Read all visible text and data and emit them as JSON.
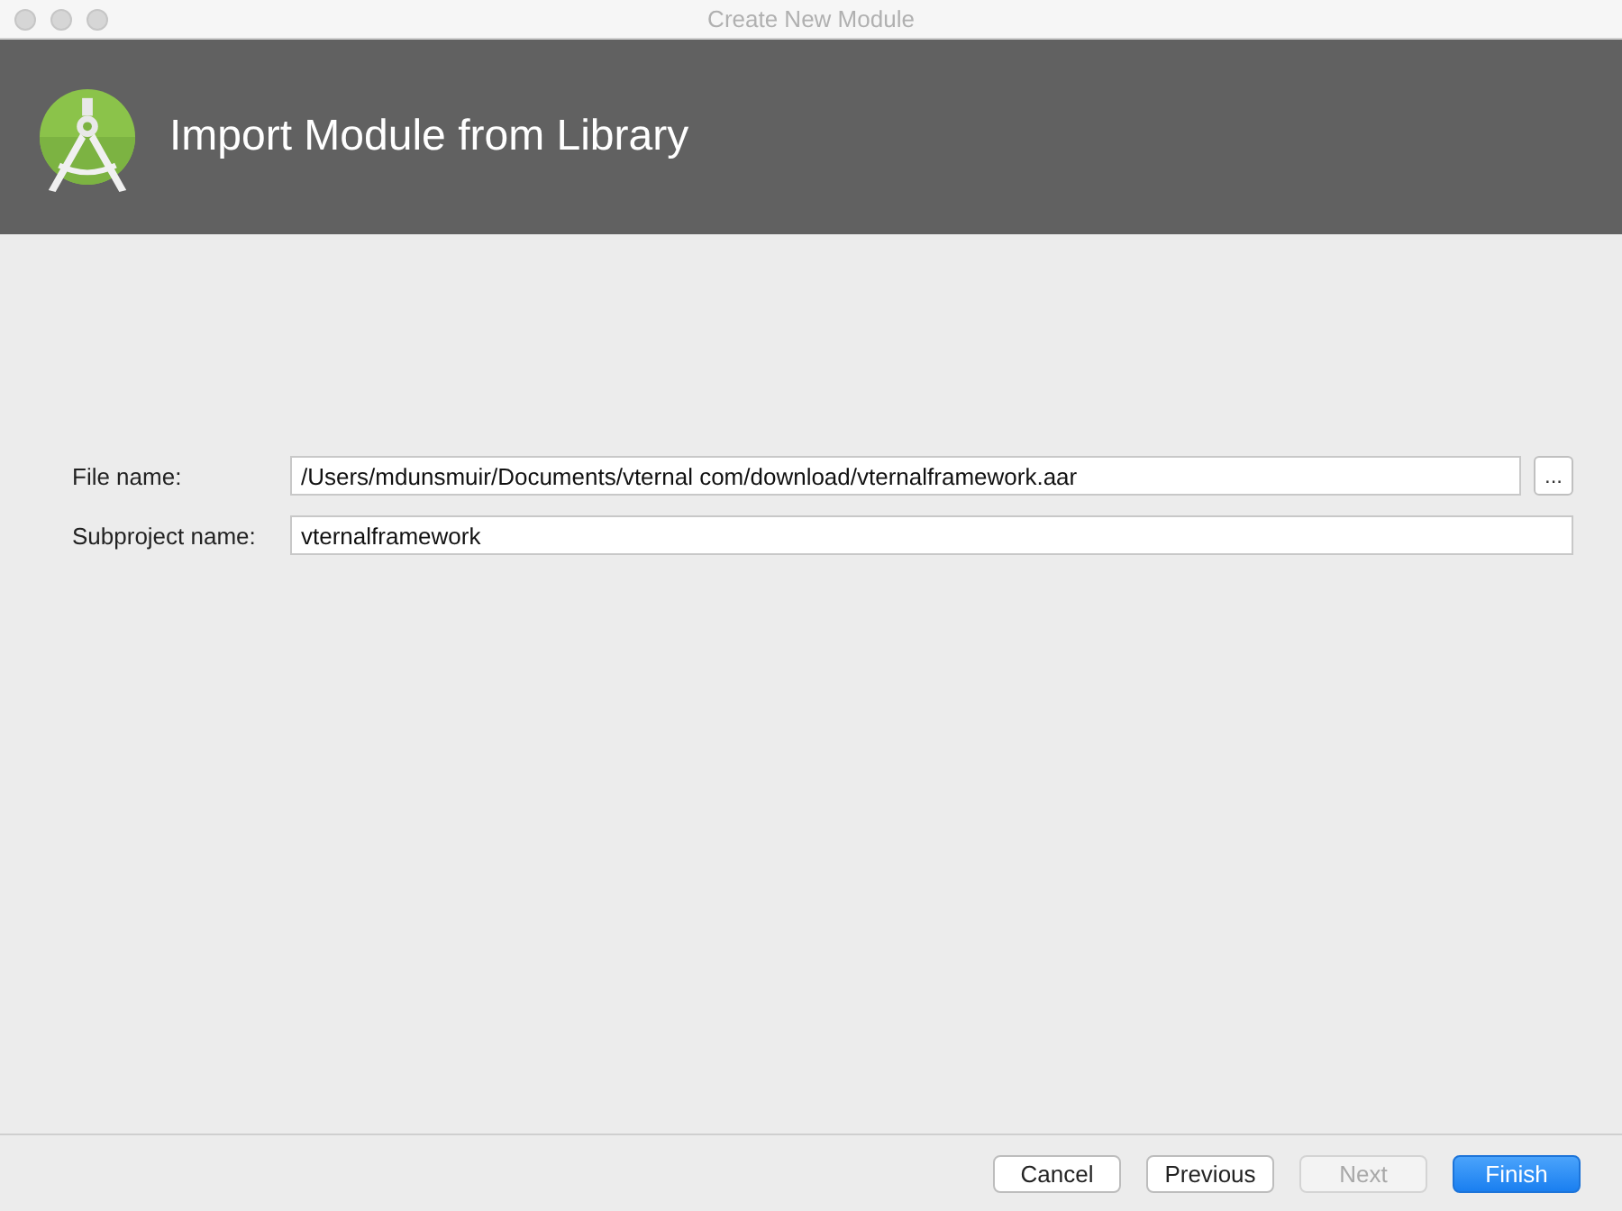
{
  "window": {
    "title": "Create New Module"
  },
  "header": {
    "title": "Import Module from Library"
  },
  "fields": [
    {
      "label": "File name:",
      "value": "/Users/mdunsmuir/Documents/vternal com/download/vternalframework.aar",
      "browse": "..."
    },
    {
      "label": "Subproject name:",
      "value": "vternalframework"
    }
  ],
  "buttons": [
    {
      "label": "Cancel",
      "kind": "normal",
      "disabled": false
    },
    {
      "label": "Previous",
      "kind": "normal",
      "disabled": false
    },
    {
      "label": "Next",
      "kind": "normal",
      "disabled": true
    },
    {
      "label": "Finish",
      "kind": "primary",
      "disabled": false
    }
  ]
}
